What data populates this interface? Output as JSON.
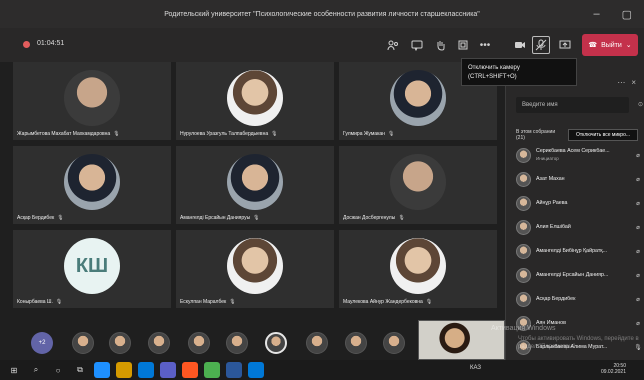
{
  "window": {
    "title": "Родительский университет \"Психологические особенности развития личности старшеклассника\""
  },
  "call": {
    "timer": "01:04:51",
    "leave_label": "Выйти",
    "tooltip": {
      "line1": "Отключить камеру",
      "line2": "(CTRL+SHIFT+O)"
    }
  },
  "participants_grid": [
    {
      "name": "Жарымбетова Махабат Махкамдаровна",
      "type": "photo"
    },
    {
      "name": "Нурулоева Уразгуль Талпабердыевна",
      "type": "photo"
    },
    {
      "name": "Гулмира Жумакан",
      "type": "photo"
    },
    {
      "name": "Асқар Бердибек",
      "type": "photo"
    },
    {
      "name": "Амангелді Ерсайын Данияруы",
      "type": "photo"
    },
    {
      "name": "Досжан Досбергенулы",
      "type": "photo"
    },
    {
      "name": "Конырбаева Ш.",
      "initials": "КШ",
      "type": "initials"
    },
    {
      "name": "Ескулпан Маралбек",
      "type": "photo"
    },
    {
      "name": "Маулекова Айнур Жандербековна",
      "type": "photo"
    }
  ],
  "panel": {
    "search_placeholder": "Введите имя",
    "section_title": "В этом собрании",
    "section_count": "(21)",
    "mute_all_label": "Отключить все микро...",
    "people": [
      {
        "name": "Серикбаева Асем Серикбае...",
        "role": "Инициатор"
      },
      {
        "name": "Азат Махан",
        "role": ""
      },
      {
        "name": "Айнұр Раева",
        "role": ""
      },
      {
        "name": "Алия Елшібай",
        "role": ""
      },
      {
        "name": "Амангелді Бибінұр Қайратқ...",
        "role": ""
      },
      {
        "name": "Амангелді Ерсайын Данияр...",
        "role": ""
      },
      {
        "name": "Асқар Бердибек",
        "role": ""
      },
      {
        "name": "Аян Иманов",
        "role": ""
      },
      {
        "name": "Барлыкбаева Алима Мурат...",
        "role": ""
      }
    ]
  },
  "bottom": {
    "more_label": "+2",
    "activate_text_1": "Активация Windows",
    "activate_text_2": "Чтобы активировать Windows, перейдите в",
    "activate_text_3": "раздел \"Параметры\"."
  },
  "taskbar": {
    "language": "КАЗ",
    "time": "20:50",
    "date": "09.02.2021"
  }
}
